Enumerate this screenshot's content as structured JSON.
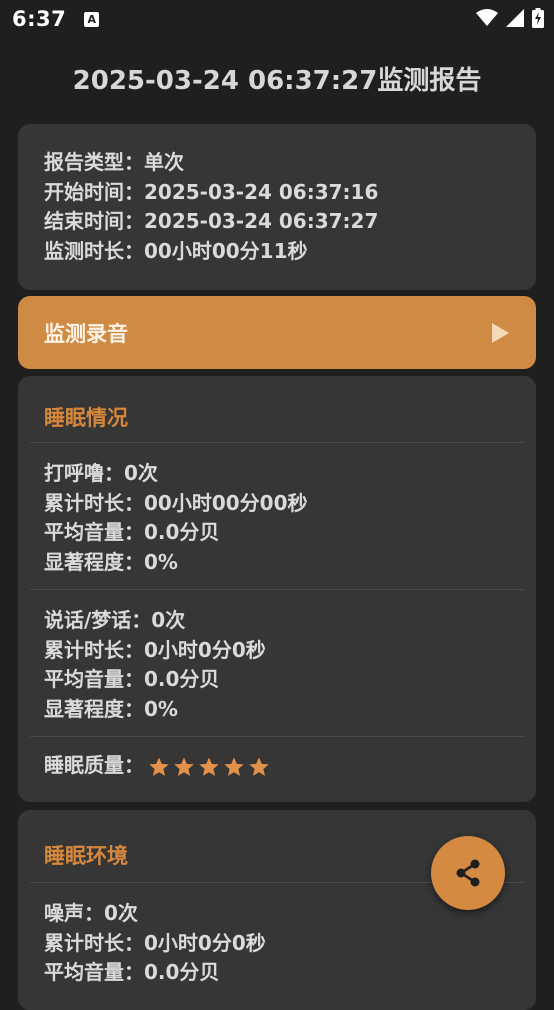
{
  "status_bar": {
    "time": "6:37",
    "notif_icon_letter": "A"
  },
  "title": "2025-03-24 06:37:27监测报告",
  "info": [
    {
      "label": "报告类型：",
      "value": "单次"
    },
    {
      "label": "开始时间：",
      "value": "2025-03-24 06:37:16"
    },
    {
      "label": "结束时间：",
      "value": "2025-03-24 06:37:27"
    },
    {
      "label": "监测时长：",
      "value": "00小时00分11秒"
    }
  ],
  "recording": {
    "label": "监测录音",
    "icon": "play-icon"
  },
  "sleep": {
    "title": "睡眠情况",
    "snore": [
      "打呼噜：0次",
      "累计时长：00小时00分00秒",
      "平均音量：0.0分贝",
      "显著程度：0%"
    ],
    "talk": [
      "说话/梦话：0次",
      "累计时长：0小时0分0秒",
      "平均音量：0.0分贝",
      "显著程度：0%"
    ],
    "quality_label": "睡眠质量：",
    "quality_stars": 5,
    "quality_max": 5
  },
  "environment": {
    "title": "睡眠环境",
    "noise": [
      "噪声：0次",
      "累计时长：0小时0分0秒",
      "平均音量：0.0分贝"
    ]
  },
  "colors": {
    "accent": "#cf8a43",
    "card": "#363636",
    "background": "#1f1f1f"
  },
  "fab": {
    "icon": "share-icon"
  }
}
